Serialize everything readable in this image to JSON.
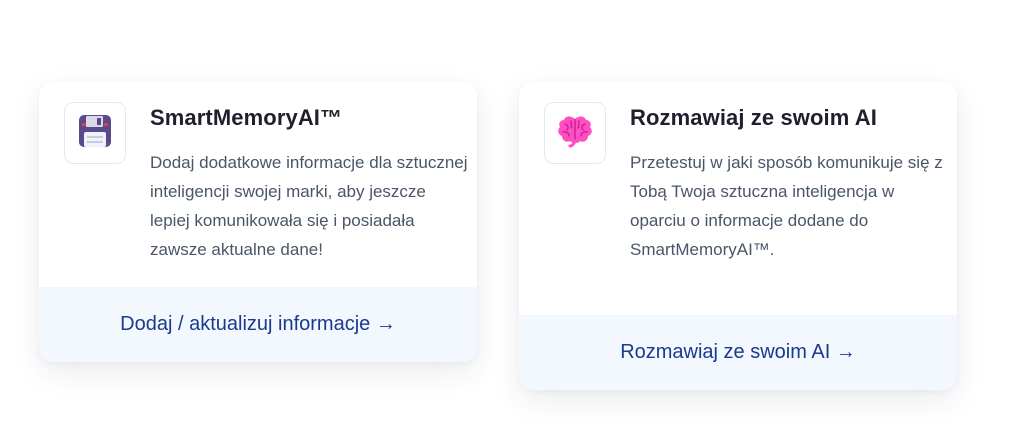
{
  "cards": [
    {
      "icon": "floppy-disk-icon",
      "title": "SmartMemoryAI™",
      "description": "Dodaj dodatkowe informacje dla sztucznej inteligencji swojej marki, aby jeszcze lepiej komunikowała się i posiadała zawsze aktualne dane!",
      "link_label": "Dodaj / aktualizuj informacje →"
    },
    {
      "icon": "brain-icon",
      "title": "Rozmawiaj ze swoim AI",
      "description": "Przetestuj w jaki sposób komunikuje się z Tobą Twoja sztuczna inteligencja w oparciu o informacje dodane do SmartMemoryAI™.",
      "link_label": "Rozmawiaj ze swoim AI →"
    }
  ],
  "colors": {
    "link": "#1a3a8f",
    "footer_bg": "#f3f7fe",
    "title": "#1f1f2e",
    "body_text": "#4a5568",
    "brain": "#ff4fc3",
    "floppy": "#5b4a8b"
  }
}
